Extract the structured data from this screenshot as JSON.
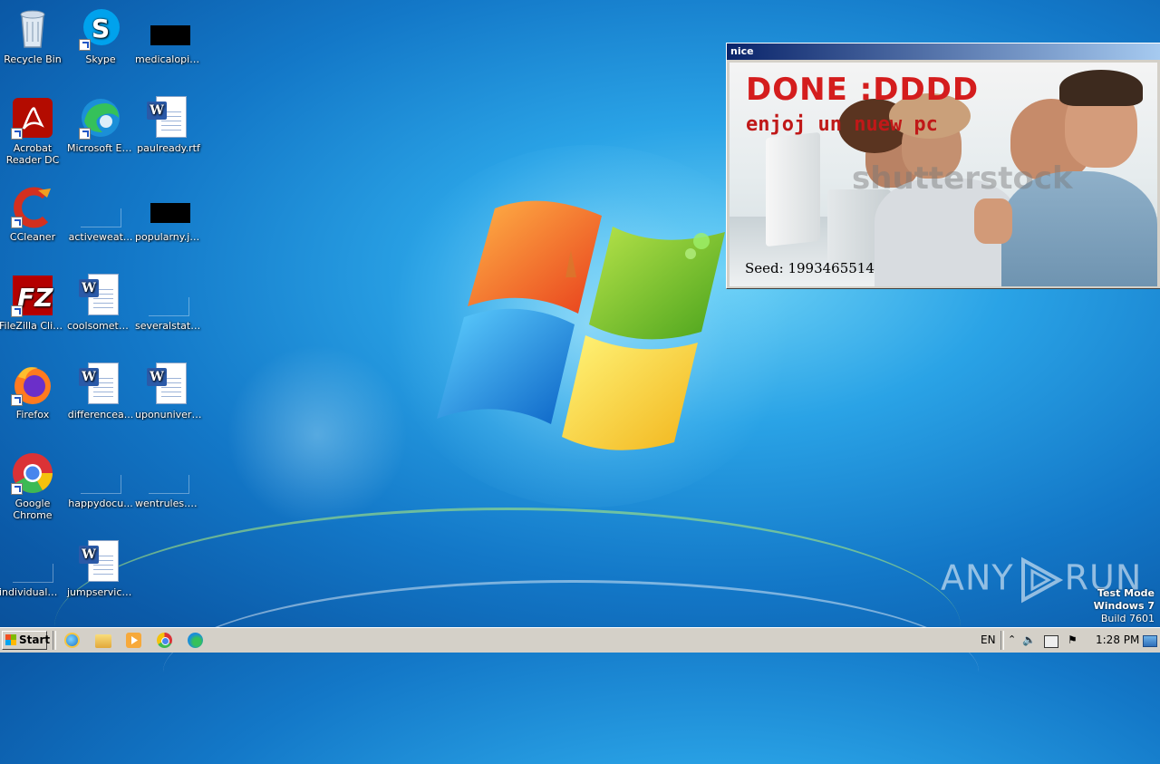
{
  "desktop": {
    "icons": [
      {
        "label": "Recycle Bin",
        "icon": "recycle-bin-icon"
      },
      {
        "label": "Skype",
        "icon": "skype-icon"
      },
      {
        "label": "medicalopini...",
        "icon": "image-file-icon"
      },
      {
        "label": "Acrobat Reader DC",
        "icon": "acrobat-reader-icon"
      },
      {
        "label": "Microsoft Edge",
        "icon": "edge-icon"
      },
      {
        "label": "paulready.rtf",
        "icon": "word-document-icon"
      },
      {
        "label": "CCleaner",
        "icon": "ccleaner-icon"
      },
      {
        "label": "activeweat...",
        "icon": "blank-file-icon"
      },
      {
        "label": "popularny.jpg",
        "icon": "image-file-icon"
      },
      {
        "label": "FileZilla Client",
        "icon": "filezilla-icon"
      },
      {
        "label": "coolsomethi...",
        "icon": "word-document-icon"
      },
      {
        "label": "severalstati...",
        "icon": "blank-file-icon"
      },
      {
        "label": "Firefox",
        "icon": "firefox-icon"
      },
      {
        "label": "differencea...",
        "icon": "word-document-icon"
      },
      {
        "label": "uponunivers...",
        "icon": "word-document-icon"
      },
      {
        "label": "Google Chrome",
        "icon": "chrome-icon"
      },
      {
        "label": "happydocu...",
        "icon": "blank-file-icon"
      },
      {
        "label": "wentrules.png",
        "icon": "blank-file-icon"
      },
      {
        "label": "individualme...",
        "icon": "blank-file-icon"
      },
      {
        "label": "jumpservice...",
        "icon": "word-document-icon"
      }
    ]
  },
  "popup": {
    "title": "nice",
    "headline": "DONE :DDDD",
    "subline": "enjoj un nuew pc",
    "watermark": "shutterstock",
    "seed": "Seed: 1993465514"
  },
  "watermark": {
    "brand_left": "ANY",
    "brand_right": "RUN",
    "test_mode": "Test Mode",
    "os": "Windows 7",
    "build": "Build 7601"
  },
  "taskbar": {
    "start_label": "Start",
    "quicklaunch": [
      "internet-explorer-icon",
      "file-explorer-icon",
      "media-player-icon",
      "chrome-icon",
      "edge-icon"
    ],
    "language": "EN",
    "clock": "1:28 PM"
  },
  "colors": {
    "desktop_blue": "#1378c8",
    "popup_red": "#d41d1d",
    "taskbar_gray": "#d4d0c8"
  }
}
